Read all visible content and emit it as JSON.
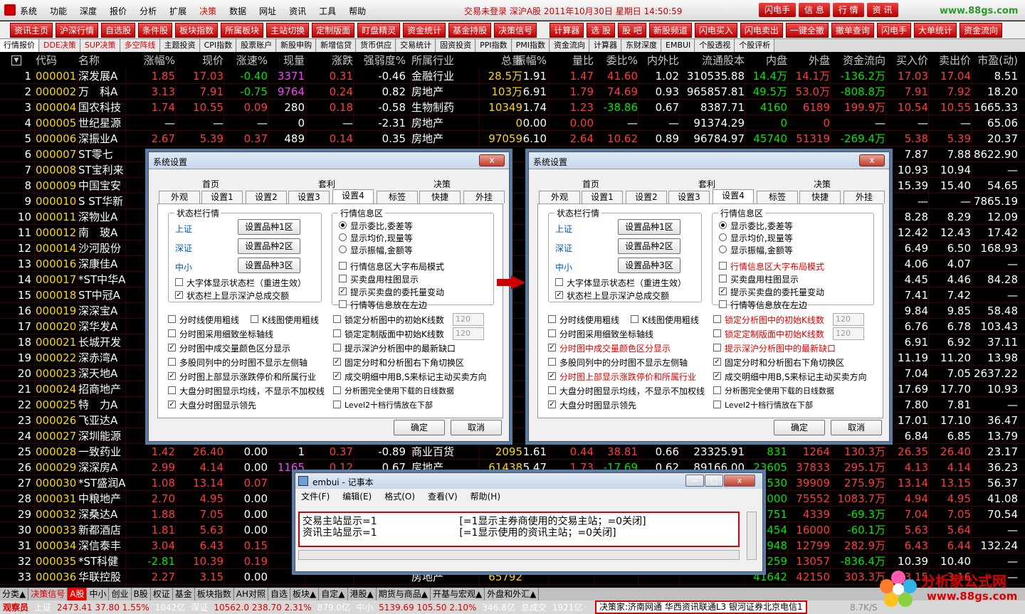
{
  "menubar": {
    "items": [
      "系统",
      "功能",
      "深度",
      "报价",
      "分析",
      "扩展",
      "决策",
      "数据",
      "网址",
      "资讯",
      "工具",
      "帮助"
    ],
    "active": "决策",
    "status": "交易未登录  深沪A股  2011年10月30日  星期日  14:50:59",
    "right_buttons": [
      "闪电手",
      "信 息",
      "行 情",
      "资 讯"
    ],
    "brand": "www.88gs.com"
  },
  "toolbar": [
    "资讯主页",
    "沪深行情",
    "自选股",
    "条件股",
    "板块指数",
    "所属板块",
    "主站切换",
    "定制版面",
    "盯盘精灵",
    "资金统计",
    "基金持股",
    "决策信号",
    "计算器",
    "选 股",
    "股 吧",
    "新股频道",
    "闪电买入",
    "闪电卖出",
    "一键全撤",
    "撤单查询",
    "闪电手",
    "大单统计",
    "资金流向"
  ],
  "tabs": [
    "行情报价",
    "DDE决策",
    "SUP决策",
    "多空阵线",
    "主题投资",
    "CPI指数",
    "股票账户",
    "新股申购",
    "新增信贷",
    "货币供应",
    "交易统计",
    "固资投资",
    "PPI指数",
    "PMI指数",
    "资金流向",
    "计算器",
    "东财深度",
    "EMBUI",
    "个股透视",
    "个股评析"
  ],
  "columns": [
    "代码",
    "名称",
    "涨幅%",
    "现价",
    "涨速%",
    "现量",
    "涨跌",
    "强弱度%",
    "所属行业",
    "总量",
    "振幅%",
    "量比",
    "委比%",
    "内外比",
    "流通股本",
    "内盘",
    "外盘",
    "资金流向",
    "买入价",
    "卖出价",
    "市盈(动)"
  ],
  "rows": [
    [
      "1",
      "000001",
      "深发展A",
      "1.85",
      "17.03",
      "-0.40",
      "3371",
      "0.31",
      "-0.46",
      "金融行业",
      "28.5万",
      "1.91",
      "1.47",
      "41.60",
      "1.02",
      "310535.88",
      "14.4万",
      "14.1万",
      "-136.2万",
      "17.03",
      "17.04",
      "8.51"
    ],
    [
      "2",
      "000002",
      "万　科A",
      "3.13",
      "7.91",
      "-0.75",
      "9764",
      "0.24",
      "0.82",
      "房地产",
      "103万",
      "6.91",
      "1.79",
      "74.69",
      "0.93",
      "965857.81",
      "49.5万",
      "53.0万",
      "-808.8万",
      "7.91",
      "7.92",
      "18.20"
    ],
    [
      "3",
      "000004",
      "国农科技",
      "1.74",
      "10.55",
      "0.09",
      "280",
      "0.18",
      "-0.58",
      "生物制药",
      "10349",
      "1.74",
      "1.23",
      "-38.86",
      "0.67",
      "8387.71",
      "4160",
      "6189",
      "199.9万",
      "10.54",
      "10.55",
      "1665.33"
    ],
    [
      "4",
      "000005",
      "世纪星源",
      "—",
      "—",
      "—",
      "0",
      "—",
      "-2.31",
      "房地产",
      "0",
      "0.00",
      "0.00",
      "—",
      "—",
      "91374.29",
      "0",
      "0",
      "—",
      "—",
      "—",
      "65.06"
    ],
    [
      "5",
      "000006",
      "深振业A",
      "2.67",
      "5.39",
      "0.37",
      "489",
      "0.14",
      "0.35",
      "房地产",
      "97059",
      "6.10",
      "2.64",
      "10.62",
      "0.89",
      "96784.97",
      "45740",
      "51319",
      "-269.4万",
      "5.38",
      "5.39",
      "20.37"
    ],
    [
      "6",
      "000007",
      "ST零七",
      "",
      "",
      "",
      "",
      "",
      "",
      "",
      "",
      "",
      "",
      "",
      "",
      "",
      "",
      "",
      "",
      "7.87",
      "7.88",
      "8622.90"
    ],
    [
      "7",
      "000008",
      "ST宝利来",
      "",
      "",
      "",
      "",
      "",
      "",
      "",
      "",
      "",
      "",
      "",
      "",
      "",
      "",
      "",
      "",
      "10.93",
      "10.94",
      "—"
    ],
    [
      "8",
      "000009",
      "中国宝安",
      "",
      "",
      "",
      "",
      "",
      "",
      "",
      "",
      "",
      "",
      "",
      "",
      "",
      "",
      "",
      "",
      "15.39",
      "15.40",
      "54.65"
    ],
    [
      "9",
      "000010",
      "S ST华新",
      "",
      "",
      "",
      "",
      "",
      "",
      "",
      "",
      "",
      "",
      "",
      "",
      "",
      "",
      "",
      "",
      "—",
      "—",
      "7865.19"
    ],
    [
      "10",
      "000011",
      "深物业A",
      "",
      "",
      "",
      "",
      "",
      "",
      "",
      "",
      "",
      "",
      "",
      "",
      "",
      "",
      "",
      "",
      "8.28",
      "8.29",
      "12.09"
    ],
    [
      "11",
      "000012",
      "南　玻A",
      "",
      "",
      "",
      "",
      "",
      "",
      "",
      "",
      "",
      "",
      "",
      "",
      "",
      "",
      "",
      "",
      "12.42",
      "12.43",
      "17.42"
    ],
    [
      "12",
      "000014",
      "沙河股份",
      "",
      "",
      "",
      "",
      "",
      "",
      "",
      "",
      "",
      "",
      "",
      "",
      "",
      "",
      "",
      "",
      "6.49",
      "6.50",
      "168.93"
    ],
    [
      "13",
      "000016",
      "深康佳A",
      "",
      "",
      "",
      "",
      "",
      "",
      "",
      "",
      "",
      "",
      "",
      "",
      "",
      "",
      "",
      "",
      "4.06",
      "4.07",
      "—"
    ],
    [
      "14",
      "000017",
      "*ST中华A",
      "",
      "",
      "",
      "",
      "",
      "",
      "",
      "",
      "",
      "",
      "",
      "",
      "",
      "",
      "",
      "",
      "4.45",
      "4.46",
      "84.28"
    ],
    [
      "15",
      "000018",
      "ST中冠A",
      "",
      "",
      "",
      "",
      "",
      "",
      "",
      "",
      "",
      "",
      "",
      "",
      "",
      "",
      "",
      "",
      "7.41",
      "7.42",
      "—"
    ],
    [
      "16",
      "000019",
      "深深宝A",
      "",
      "",
      "",
      "",
      "",
      "",
      "",
      "",
      "",
      "",
      "",
      "",
      "",
      "",
      "",
      "",
      "9.84",
      "9.85",
      "58.48"
    ],
    [
      "17",
      "000020",
      "深华发A",
      "",
      "",
      "",
      "",
      "",
      "",
      "",
      "",
      "",
      "",
      "",
      "",
      "",
      "",
      "",
      "",
      "6.76",
      "6.78",
      "103.43"
    ],
    [
      "18",
      "000021",
      "长城开发",
      "",
      "",
      "",
      "",
      "",
      "",
      "",
      "",
      "",
      "",
      "",
      "",
      "",
      "",
      "",
      "",
      "6.91",
      "6.92",
      "37.11"
    ],
    [
      "19",
      "000022",
      "深赤湾A",
      "",
      "",
      "",
      "",
      "",
      "",
      "",
      "",
      "",
      "",
      "",
      "",
      "",
      "",
      "",
      "",
      "11.19",
      "11.20",
      "13.98"
    ],
    [
      "20",
      "000023",
      "深天地A",
      "",
      "",
      "",
      "",
      "",
      "",
      "",
      "",
      "",
      "",
      "",
      "",
      "",
      "",
      "",
      "",
      "7.04",
      "7.05",
      "2637.22"
    ],
    [
      "21",
      "000024",
      "招商地产",
      "",
      "",
      "",
      "",
      "",
      "",
      "",
      "",
      "",
      "",
      "",
      "",
      "",
      "",
      "",
      "",
      "17.69",
      "17.70",
      "10.93"
    ],
    [
      "22",
      "000025",
      "特　力A",
      "",
      "",
      "",
      "",
      "",
      "",
      "",
      "",
      "",
      "",
      "",
      "",
      "",
      "",
      "",
      "",
      "7.80",
      "7.81",
      "—"
    ],
    [
      "23",
      "000026",
      "飞亚达A",
      "",
      "",
      "",
      "",
      "",
      "",
      "",
      "",
      "",
      "",
      "",
      "",
      "",
      "",
      "",
      "",
      "17.01",
      "17.10",
      "36.47"
    ],
    [
      "24",
      "000027",
      "深圳能源",
      "",
      "",
      "",
      "",
      "",
      "",
      "",
      "",
      "",
      "",
      "",
      "",
      "",
      "",
      "",
      "",
      "6.84",
      "6.85",
      "13.79"
    ],
    [
      "25",
      "000028",
      "一致药业",
      "1.42",
      "26.40",
      "0.00",
      "1",
      "0.37",
      "-0.89",
      "商业百货",
      "2095",
      "1.61",
      "0.44",
      "38.81",
      "0.66",
      "23325.91",
      "831",
      "1264",
      "130.3万",
      "26.35",
      "26.40",
      "23.17"
    ],
    [
      "26",
      "000029",
      "深深房A",
      "2.99",
      "4.14",
      "0.00",
      "1165",
      "0.12",
      "0.67",
      "房地产",
      "61438",
      "5.47",
      "1.73",
      "-17.69",
      "0.62",
      "89166.00",
      "23605",
      "37833",
      "295.1万",
      "4.13",
      "4.14",
      "36.23"
    ],
    [
      "27",
      "000030",
      "*ST盛润A",
      "1.08",
      "13.14",
      "0.07",
      "",
      "",
      "",
      "",
      "",
      "",
      "",
      "",
      "",
      "",
      "13530",
      "39909",
      "275.9万",
      "13.14",
      "13.15",
      "56.37"
    ],
    [
      "28",
      "000031",
      "中粮地产",
      "2.70",
      "4.95",
      "0.00",
      "",
      "",
      "",
      "",
      "",
      "",
      "",
      "",
      "",
      "",
      "32000",
      "75552",
      "1083.7万",
      "4.94",
      "4.95",
      "41.08"
    ],
    [
      "29",
      "000032",
      "深桑达A",
      "1.88",
      "7.05",
      "0.00",
      "",
      "",
      "",
      "",
      "",
      "",
      "",
      "",
      "",
      "",
      "5751",
      "4339",
      "-69.3万",
      "7.04",
      "7.05",
      "70.54"
    ],
    [
      "30",
      "000033",
      "新都酒店",
      "1.81",
      "5.63",
      "0.00",
      "",
      "",
      "",
      "",
      "",
      "",
      "",
      "",
      "",
      "",
      "13454",
      "16000",
      "-60.1万",
      "5.63",
      "5.64",
      "—"
    ],
    [
      "31",
      "000034",
      "深信泰丰",
      "3.04",
      "6.43",
      "0.15",
      "",
      "",
      "",
      "",
      "",
      "",
      "",
      "",
      "",
      "",
      "7948",
      "12799",
      "282.9万",
      "6.43",
      "6.44",
      "132.24"
    ],
    [
      "32",
      "000035",
      "*ST科健",
      "-2.81",
      "10.39",
      "0.19",
      "",
      "",
      "",
      "",
      "",
      "",
      "",
      "",
      "",
      "",
      "11259",
      "13057",
      "-836.4万",
      "10.39",
      "10.40",
      "—"
    ],
    [
      "33",
      "000036",
      "华联控股",
      "2.27",
      "3.15",
      "0.00",
      "",
      "",
      "",
      "房地产",
      "65792",
      "",
      "",
      "",
      "",
      "",
      "41642",
      "42150",
      "303.3万",
      "3.15",
      "3.16",
      "—"
    ]
  ],
  "dialog": {
    "title": "系统设置",
    "close": "x",
    "tabs_top": [
      "首页",
      "套利",
      "决策"
    ],
    "tabs": [
      "外观",
      "设置1",
      "设置2",
      "设置3",
      "设置4",
      "标签",
      "快捷",
      "外挂"
    ],
    "status_group": "状态栏行情",
    "markets": [
      "上证",
      "深证",
      "中小"
    ],
    "market_buttons": [
      "设置品种1区",
      "设置品种2区",
      "设置品种3区"
    ],
    "status_checks": [
      "大字体显示状态栏（重进生效）",
      "状态栏上显示深沪总成交额"
    ],
    "info_group": "行情信息区",
    "radios": [
      "显示委比,委差等",
      "显示均价,现量等",
      "显示振幅,金额等"
    ],
    "info_checks": [
      "行情信息区大字布局模式",
      "买卖盘用柱图显示",
      "提示买卖盘的委托量变动",
      "行情等信息放在左边"
    ],
    "left_checks": [
      "分时线使用粗线",
      "分时图采用细致坐标轴线",
      "分时图中成交量颜色区分显示",
      "多股同列中的分时图不显示左侧轴",
      "分时图上部显示涨跌停价和所属行业",
      "大盘分时图显示均线，不显示不加权线",
      "大盘分时图显示领先"
    ],
    "k_check": "K线图使用粗线",
    "right_checks": [
      "锁定分析图中的初始K线数",
      "锁定定制版面中初始K线数",
      "提示深沪分析图中的最新缺口",
      "固定分时和分析图右下角切换区",
      "成交明细中用B,S来标记主动买卖方向",
      "分析图完全使用下载的日线数据",
      "Level2十档行情放在下部"
    ],
    "num_value": "120",
    "ok": "确定",
    "cancel": "取消"
  },
  "notepad": {
    "title": "embui - 记事本",
    "menus": [
      "文件(F)",
      "编辑(E)",
      "格式(O)",
      "查看(V)",
      "帮助(H)"
    ],
    "line1": "交易主站显示=1                          [=1显示主券商使用的交易主站；=0关闭]",
    "line2": "资讯主站显示=1                          [=1显示使用的资讯主站；=0关闭]"
  },
  "sheettabs": [
    "分类▲",
    "决策信号",
    "A股",
    "中小",
    "创业",
    "B股",
    "权证",
    "基金",
    "板块指数",
    "AH对照",
    "自选",
    "板块▲",
    "自定▲",
    "港股▲",
    "期货与商品▲",
    "开基与宏观▲",
    "外盘和外汇▲"
  ],
  "statusbar": {
    "label": "观察员",
    "sh": "上证",
    "sh_val": "2473.41  37.80  1.55%",
    "sh_amt": "1042亿",
    "sz": "深证",
    "sz_val": "10562.0  238.70  2.31%",
    "sz_amt": "879.0亿",
    "zx": "中小",
    "zx_val": "5139.69  105.50  2.10%",
    "zx_amt": "346.8亿",
    "total": "总成交",
    "total_amt": "1921亿",
    "hosts": "决策家:济南网通  华西资讯联通L3  银河证券北京电信1",
    "speed": "8.7K/S"
  },
  "sitelogo": {
    "title": "分析家公式网",
    "url": "www.88gs.com"
  }
}
